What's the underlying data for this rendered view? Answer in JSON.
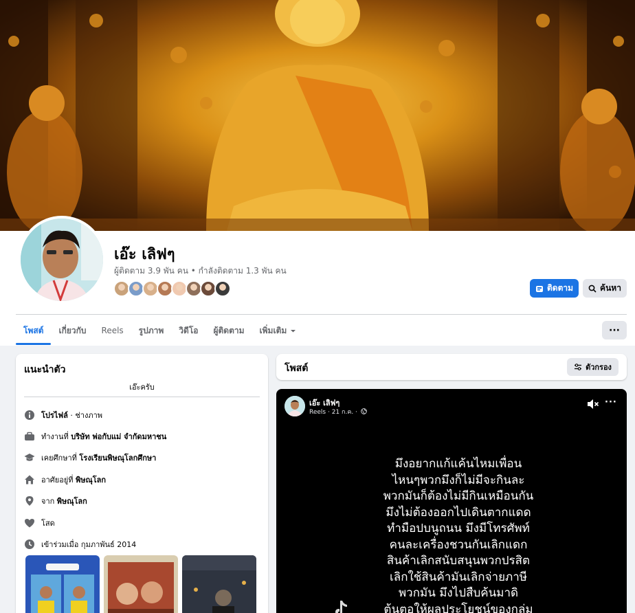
{
  "profile": {
    "name": "เอ๊ะ เลิฟๆ",
    "stats": "ผู้ติดตาม 3.9 พัน คน • กำลังติดตาม 1.3 พัน คน",
    "follow_label": "ติดตาม",
    "search_label": "ค้นหา",
    "follower_avatar_colors": [
      "#c9a27a",
      "#7a9cc9",
      "#d8b08a",
      "#b57a55",
      "#f0c9b0",
      "#8e6f5a",
      "#6b4a3a",
      "#3a3a3a"
    ]
  },
  "tabs": [
    {
      "label": "โพสต์",
      "active": true
    },
    {
      "label": "เกี่ยวกับ",
      "active": false
    },
    {
      "label": "Reels",
      "active": false
    },
    {
      "label": "รูปภาพ",
      "active": false
    },
    {
      "label": "วิดีโอ",
      "active": false
    },
    {
      "label": "ผู้ติดตาม",
      "active": false
    },
    {
      "label": "เพิ่มเติม",
      "active": false
    }
  ],
  "more_button": "···",
  "intro": {
    "title": "แนะนำตัว",
    "bio": "เอ๊ะครับ",
    "rows": [
      {
        "icon": "info-icon",
        "prefix": "",
        "bold": "โปรไฟล์",
        "suffix": " · ช่างภาพ"
      },
      {
        "icon": "briefcase-icon",
        "prefix": "ทำงานที่ ",
        "bold": "บริษัท พ่อกับแม่ จำกัดมหาชน",
        "suffix": ""
      },
      {
        "icon": "graduation-cap-icon",
        "prefix": "เคยศึกษาที่ ",
        "bold": "โรงเรียนพิษณุโลกศึกษา",
        "suffix": ""
      },
      {
        "icon": "home-icon",
        "prefix": "อาศัยอยู่ที่ ",
        "bold": "พิษณุโลก",
        "suffix": ""
      },
      {
        "icon": "location-pin-icon",
        "prefix": "จาก ",
        "bold": "พิษณุโลก",
        "suffix": ""
      },
      {
        "icon": "heart-icon",
        "prefix": "โสด",
        "bold": "",
        "suffix": ""
      },
      {
        "icon": "clock-icon",
        "prefix": "เข้าร่วมเมื่อ กุมภาพันธ์ 2014",
        "bold": "",
        "suffix": ""
      }
    ]
  },
  "posts": {
    "title": "โพสต์",
    "filter_label": "ตัวกรอง"
  },
  "reel": {
    "author": "เอ๊ะ เลิฟๆ",
    "meta": "Reels · 21 ก.ค. ·",
    "caption_lines": [
      "มึงอยากแก้แค้นไหมเพื่อน",
      "ไหนๆพวกมึงก็ไม่มีจะกินละ",
      "พวกมันก็ต้องไม่มีกินเหมือนกัน",
      "มึงไม่ต้องออกไปเดินตากแดด",
      "ทำมือปบนูถนน มึงมีโทรศัพท์",
      "คนละเครื่องชวนกันเลิกแดก",
      "สินค้าเลิกสนับสนุนพวกปรสิต",
      "เลิกใช้สินค้ามันเลิกจ่ายภาษี",
      "พวกมัน  มึงไปสืบค้นมาดิ",
      "ต้นตอให้ผลประโยชน์ของกลุ่ม"
    ]
  }
}
